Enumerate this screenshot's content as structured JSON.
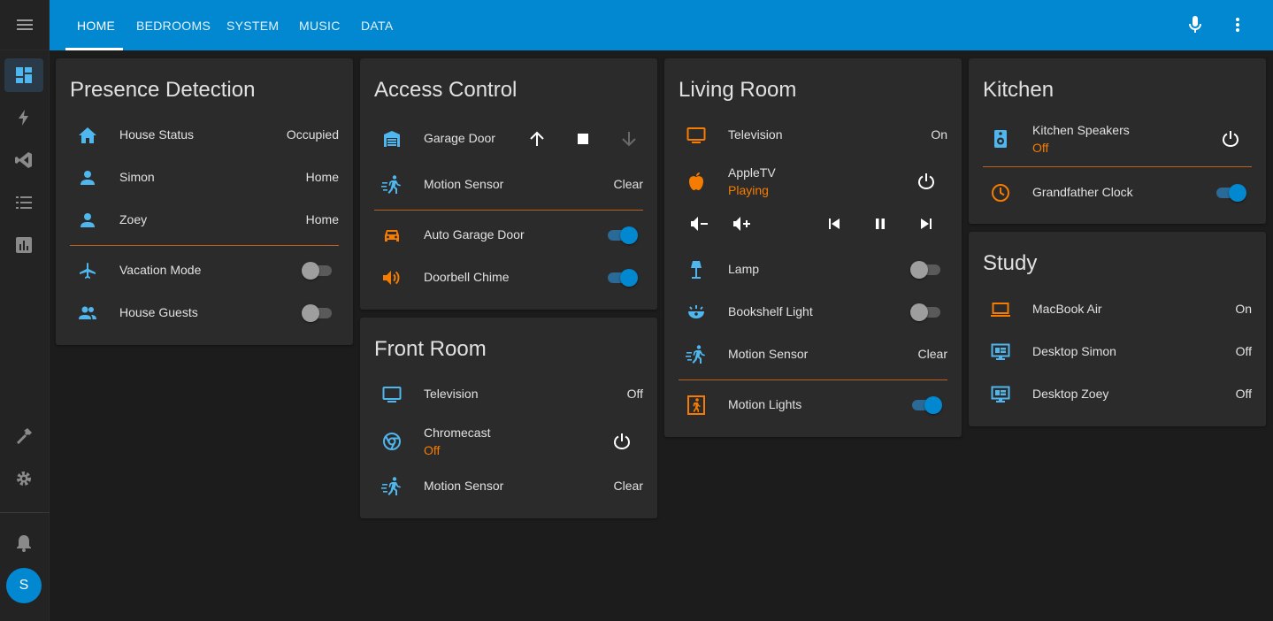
{
  "colors": {
    "header": "#0288d1",
    "accent_orange": "#f57c00",
    "icon_blue": "#4fb6ee",
    "background": "#1c1c1c",
    "card": "#2b2b2b"
  },
  "header": {
    "tabs": [
      {
        "label": "HOME"
      },
      {
        "label": "BEDROOMS"
      },
      {
        "label": "SYSTEM"
      },
      {
        "label": "MUSIC"
      },
      {
        "label": "DATA"
      }
    ],
    "active_tab": "HOME",
    "icons": [
      "microphone-icon",
      "more-vert-icon"
    ]
  },
  "sidebar": {
    "items": [
      "menu-icon",
      "dashboard-icon",
      "lightning-icon",
      "vscode-icon",
      "list-icon",
      "chart-icon",
      "hammer-icon",
      "settings-icon",
      "bell-icon"
    ],
    "avatar": "S"
  },
  "presence": {
    "title": "Presence Detection",
    "rows": [
      {
        "name": "House Status",
        "value": "Occupied",
        "icon": "home-icon"
      },
      {
        "name": "Simon",
        "value": "Home",
        "icon": "person-icon"
      },
      {
        "name": "Zoey",
        "value": "Home",
        "icon": "person-icon"
      },
      {
        "name": "Vacation Mode",
        "state": "off",
        "icon": "airplane-icon"
      },
      {
        "name": "House Guests",
        "state": "off",
        "icon": "people-icon"
      }
    ]
  },
  "access": {
    "title": "Access Control",
    "rows": [
      {
        "name": "Garage Door",
        "icon": "garage-icon"
      },
      {
        "name": "Motion Sensor",
        "value": "Clear",
        "icon": "motion-icon"
      },
      {
        "name": "Auto Garage Door",
        "state": "on",
        "icon": "car-icon"
      },
      {
        "name": "Doorbell Chime",
        "state": "on",
        "icon": "speaker-icon"
      }
    ]
  },
  "front": {
    "title": "Front Room",
    "rows": [
      {
        "name": "Television",
        "value": "Off",
        "icon": "tv-icon"
      },
      {
        "name": "Chromecast",
        "sub": "Off",
        "icon": "chrome-icon"
      },
      {
        "name": "Motion Sensor",
        "value": "Clear",
        "icon": "motion-icon"
      }
    ]
  },
  "living": {
    "title": "Living Room",
    "rows": [
      {
        "name": "Television",
        "value": "On",
        "icon": "tv-icon"
      },
      {
        "name": "AppleTV",
        "sub": "Playing",
        "icon": "apple-icon"
      },
      {
        "name": "Lamp",
        "state": "off",
        "icon": "lamp-icon"
      },
      {
        "name": "Bookshelf Light",
        "state": "off",
        "icon": "bowl-light-icon"
      },
      {
        "name": "Motion Sensor",
        "value": "Clear",
        "icon": "motion-icon"
      },
      {
        "name": "Motion Lights",
        "state": "on",
        "icon": "exit-run-icon"
      }
    ]
  },
  "kitchen": {
    "title": "Kitchen",
    "rows": [
      {
        "name": "Kitchen Speakers",
        "sub": "Off",
        "icon": "speaker-box-icon"
      },
      {
        "name": "Grandfather Clock",
        "state": "on",
        "icon": "clock-icon"
      }
    ]
  },
  "study": {
    "title": "Study",
    "rows": [
      {
        "name": "MacBook Air",
        "value": "On",
        "icon": "laptop-icon"
      },
      {
        "name": "Desktop Simon",
        "value": "Off",
        "icon": "desktop-icon"
      },
      {
        "name": "Desktop Zoey",
        "value": "Off",
        "icon": "desktop-icon"
      }
    ]
  }
}
